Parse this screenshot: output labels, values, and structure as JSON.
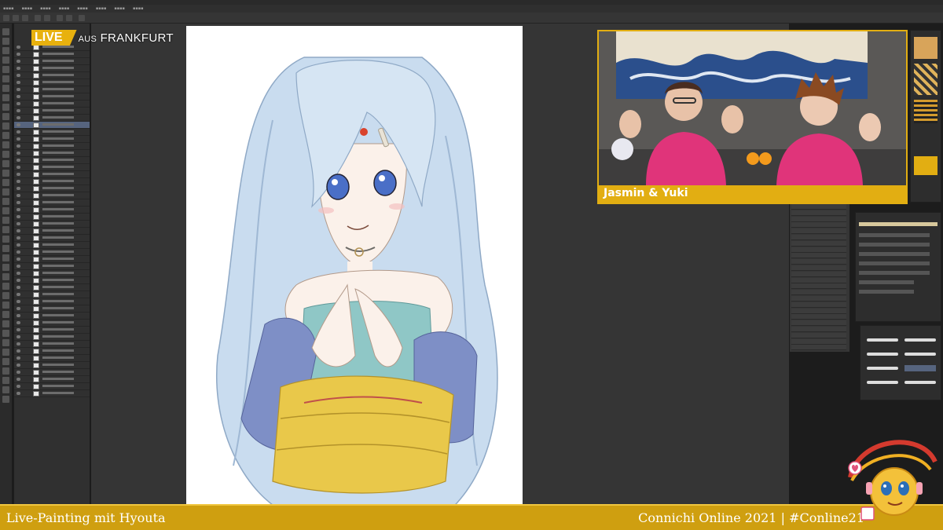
{
  "overlay": {
    "live_label": "LIVE",
    "location_prefix": "AUS",
    "location": "FRANKFURT"
  },
  "webcam": {
    "names": "Jasmin & Yuki"
  },
  "bottom_bar": {
    "left_text": "Live-Painting mit Hyouta",
    "right_text": "Connichi Online 2021 | #Conline21"
  },
  "colors": {
    "accent_gold": "#e2ae12",
    "bar_gold": "#cf9f10",
    "app_dark": "#353535",
    "layer_selected": "#56647e"
  }
}
